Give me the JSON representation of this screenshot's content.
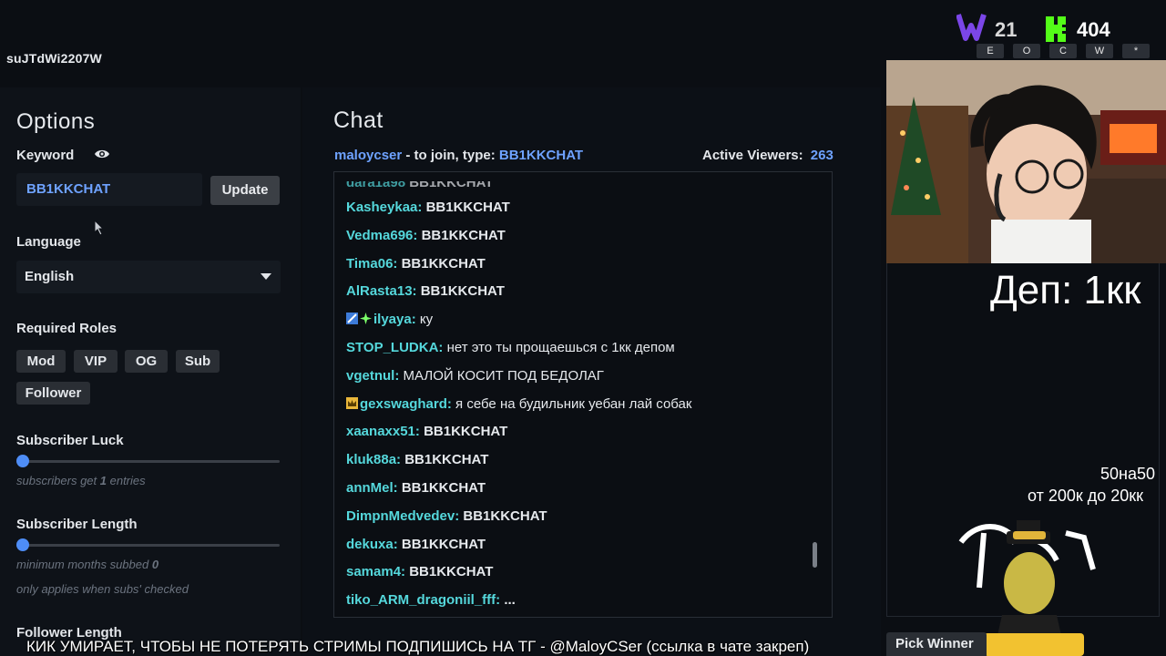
{
  "top_id": "suJTdWi2207W",
  "options": {
    "title": "Options",
    "keyword_label": "Keyword",
    "keyword_value": "BB1KKCHAT",
    "update_label": "Update",
    "language_label": "Language",
    "language_value": "English",
    "required_roles_label": "Required Roles",
    "roles": [
      "Mod",
      "VIP",
      "OG",
      "Sub",
      "Follower"
    ],
    "subscriber_luck_label": "Subscriber Luck",
    "subscriber_luck_hint_pre": "subscribers get ",
    "subscriber_luck_value": "1",
    "subscriber_luck_hint_post": " entries",
    "subscriber_length_label": "Subscriber Length",
    "subscriber_length_hint_pre": "minimum months subbed ",
    "subscriber_length_value": "0",
    "subscriber_length_hint2": "only applies when subs' checked",
    "follower_length_label": "Follower Length"
  },
  "chat": {
    "title": "Chat",
    "channel": "maloycser",
    "join_text": " - to join, type: ",
    "join_keyword": "BB1KKCHAT",
    "active_viewers_label": "Active Viewers:",
    "active_viewers_value": "263",
    "messages": [
      {
        "user": "Kasheykaa:",
        "text": "BB1KKCHAT",
        "plain": false
      },
      {
        "user": "Vedma696:",
        "text": "BB1KKCHAT",
        "plain": false
      },
      {
        "user": "Tima06:",
        "text": "BB1KKCHAT",
        "plain": false
      },
      {
        "user": "AlRasta13:",
        "text": "BB1KKCHAT",
        "plain": false
      },
      {
        "user": "ilyaya:",
        "text": "ку",
        "plain": true,
        "badge": "twin"
      },
      {
        "user": "STOP_LUDKA:",
        "text": "нет это ты прощаешься с 1кк депом",
        "plain": true
      },
      {
        "user": "vgetnul:",
        "text": "МАЛОЙ КОСИТ ПОД БЕДОЛАГ",
        "plain": true
      },
      {
        "user": "gexswaghard:",
        "text": "я себе на будильник уебан лай собак",
        "plain": true,
        "badge": "crown"
      },
      {
        "user": "xaanaxx51:",
        "text": "BB1KKCHAT",
        "plain": false
      },
      {
        "user": "kluk88a:",
        "text": "BB1KKCHAT",
        "plain": false
      },
      {
        "user": "annMel:",
        "text": "BB1KKCHAT",
        "plain": false
      },
      {
        "user": "DimpnMedvedev:",
        "text": "BB1KKCHAT",
        "plain": false
      },
      {
        "user": "dekuxa:",
        "text": "BB1KKCHAT",
        "plain": false
      },
      {
        "user": "samam4:",
        "text": "BB1KKCHAT",
        "plain": false
      },
      {
        "user": "tiko_ARM_dragoniil_fff:",
        "text": "...",
        "plain": false
      }
    ]
  },
  "overlay": {
    "dep_text": "Деп: 1кк",
    "promo_line1": "50на50",
    "promo_line2": "от 200к до 20кк",
    "pick_winner": "Pick Winner",
    "ticker": "КИК УМИРАЕТ, ЧТОБЫ НЕ ПОТЕРЯТЬ СТРИМЫ ПОДПИШИСЬ НА ТГ - @MaloyCSer (ссылка в чате закреп)",
    "score_w": "21",
    "score_k": "404",
    "keys": [
      "E",
      "O",
      "C",
      "W",
      "*"
    ]
  }
}
